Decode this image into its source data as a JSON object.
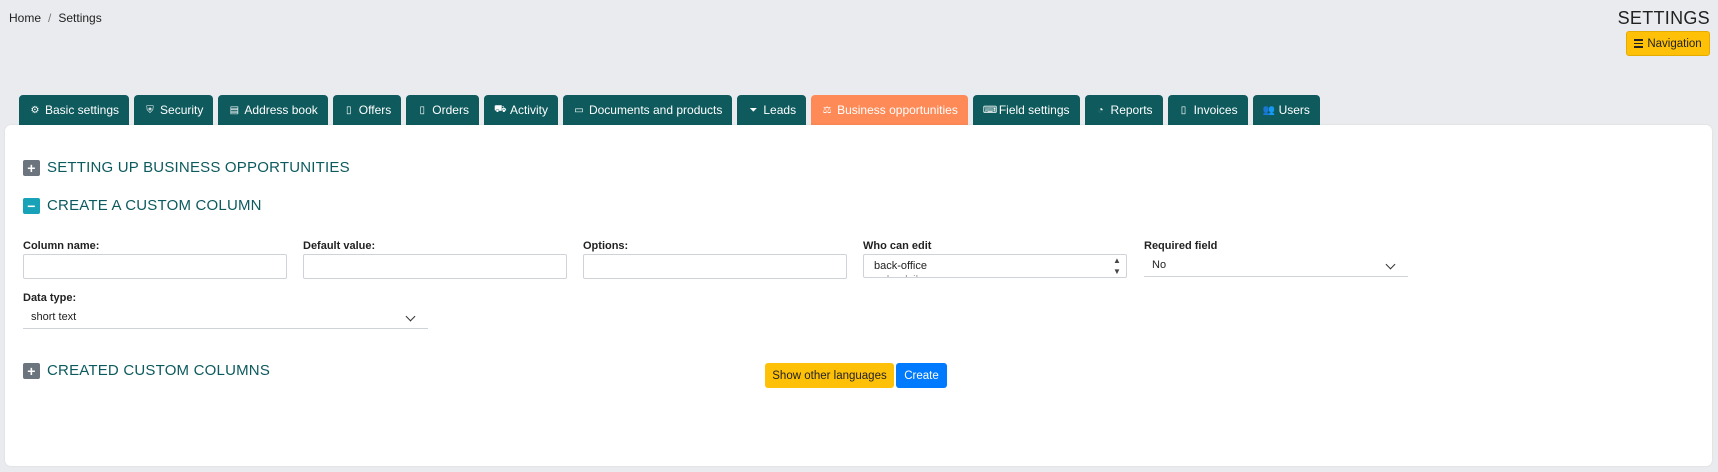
{
  "breadcrumb": {
    "home": "Home",
    "separator": "/",
    "current": "Settings"
  },
  "header": {
    "title": "SETTINGS",
    "nav_button": "Navigation",
    "nav_icon": "bars-icon"
  },
  "tabs": [
    {
      "label": "Basic settings",
      "icon": "cogs-icon",
      "glyph": "⚙"
    },
    {
      "label": "Security",
      "icon": "shield-icon",
      "glyph": "⛨"
    },
    {
      "label": "Address book",
      "icon": "address-card-icon",
      "glyph": "▤"
    },
    {
      "label": "Offers",
      "icon": "file-icon",
      "glyph": "▯"
    },
    {
      "label": "Orders",
      "icon": "file-icon",
      "glyph": "▯"
    },
    {
      "label": "Activity",
      "icon": "truck-icon",
      "glyph": "⛟"
    },
    {
      "label": "Documents and products",
      "icon": "folder-open-icon",
      "glyph": "▭"
    },
    {
      "label": "Leads",
      "icon": "funnel-icon",
      "glyph": "⏷"
    },
    {
      "label": "Business opportunities",
      "icon": "balance-scale-icon",
      "glyph": "⚖",
      "active": true
    },
    {
      "label": "Field settings",
      "icon": "keyboard-icon",
      "glyph": "⌨"
    },
    {
      "label": "Reports",
      "icon": "pie-chart-icon",
      "glyph": "◔"
    },
    {
      "label": "Invoices",
      "icon": "invoice-icon",
      "glyph": "▯"
    },
    {
      "label": "Users",
      "icon": "users-icon",
      "glyph": "👥"
    }
  ],
  "colors": {
    "tab": "#0e5a5d",
    "active_tab": "#fd8a57",
    "heading": "#0d5a5e"
  },
  "sections": {
    "setup": "SETTING UP BUSINESS OPPORTUNITIES",
    "create": "CREATE A CUSTOM COLUMN",
    "created": "CREATED CUSTOM COLUMNS"
  },
  "form": {
    "column_name_label": "Column name:",
    "column_name_value": "",
    "default_value_label": "Default value:",
    "default_value_value": "",
    "options_label": "Options:",
    "options_value": "",
    "who_can_edit_label": "Who can edit",
    "who_can_edit_options": [
      "back-office",
      "mdandzik"
    ],
    "required_label": "Required field",
    "required_value": "No",
    "data_type_label": "Data type:",
    "data_type_value": "short text"
  },
  "buttons": {
    "show_languages": "Show other languages",
    "create": "Create"
  }
}
